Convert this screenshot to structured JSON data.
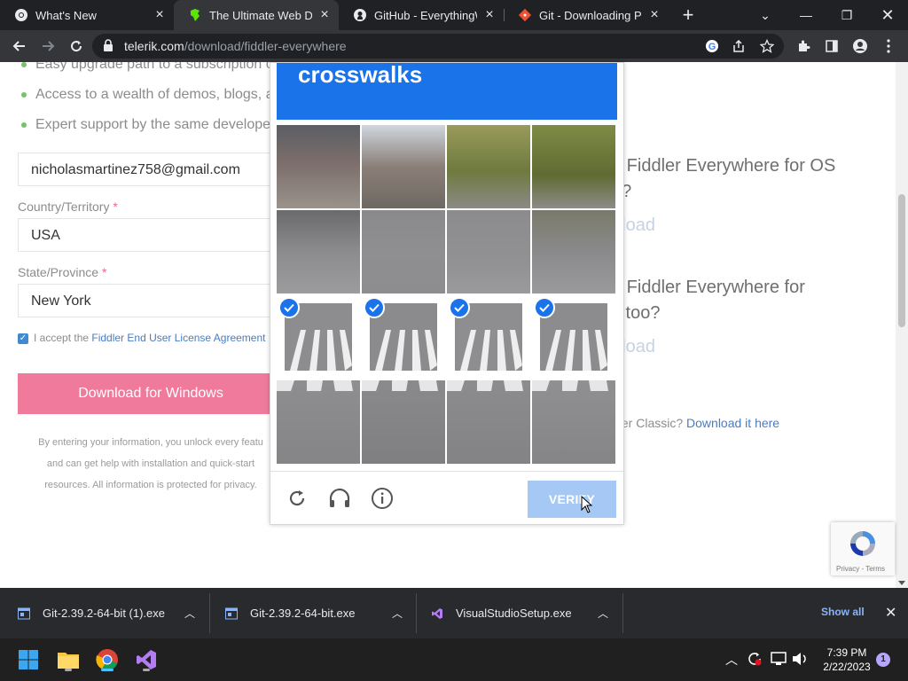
{
  "browser": {
    "tabs": [
      {
        "title": "What's New"
      },
      {
        "title": "The Ultimate Web Debu"
      },
      {
        "title": "GitHub - EverythingWi"
      },
      {
        "title": "Git - Downloading Pack"
      }
    ],
    "url_host": "telerik.com",
    "url_path": "/download/fiddler-everywhere"
  },
  "page": {
    "bullets": [
      "Easy upgrade path to a subscription o",
      "Access to a wealth of demos, blogs, a",
      "Expert support by the same develope"
    ],
    "email_value": "nicholasmartinez758@gmail.com",
    "country_label": "Country/Territory",
    "country_value": "USA",
    "state_label": "State/Province",
    "state_value": "New York",
    "required_mark": "*",
    "agree_prefix": "I accept the ",
    "agree_link": "Fiddler End User License Agreement",
    "download_button": "Download for Windows",
    "fine_print": [
      "By entering your information, you unlock every featu",
      "and can get help with installation and quick-start",
      "resources. All information is protected for privacy."
    ],
    "right_heading_1a": "d Fiddler Everywhere for OS",
    "right_heading_1b": "o?",
    "right_link_1": "nload",
    "right_heading_2a": "d Fiddler Everywhere for",
    "right_heading_2b": "x too?",
    "right_link_2": "nload",
    "classic_prefix": "dler Classic? ",
    "classic_link": "Download it here",
    "recaptcha_badge_text": "Privacy - Terms"
  },
  "captcha": {
    "header_word": "crosswalks",
    "selected_tiles": [
      8,
      9,
      10,
      11
    ],
    "verify_label": "VERIFY"
  },
  "downloads": [
    {
      "name": "Git-2.39.2-64-bit (1).exe"
    },
    {
      "name": "Git-2.39.2-64-bit.exe"
    },
    {
      "name": "VisualStudioSetup.exe"
    }
  ],
  "downloads_show_all": "Show all",
  "taskbar": {
    "time": "7:39 PM",
    "date": "2/22/2023",
    "notification_count": "1"
  },
  "colors": {
    "captcha_blue": "#1a73e8",
    "download_pink": "#f07a9c",
    "accent_green": "#77c36b"
  }
}
